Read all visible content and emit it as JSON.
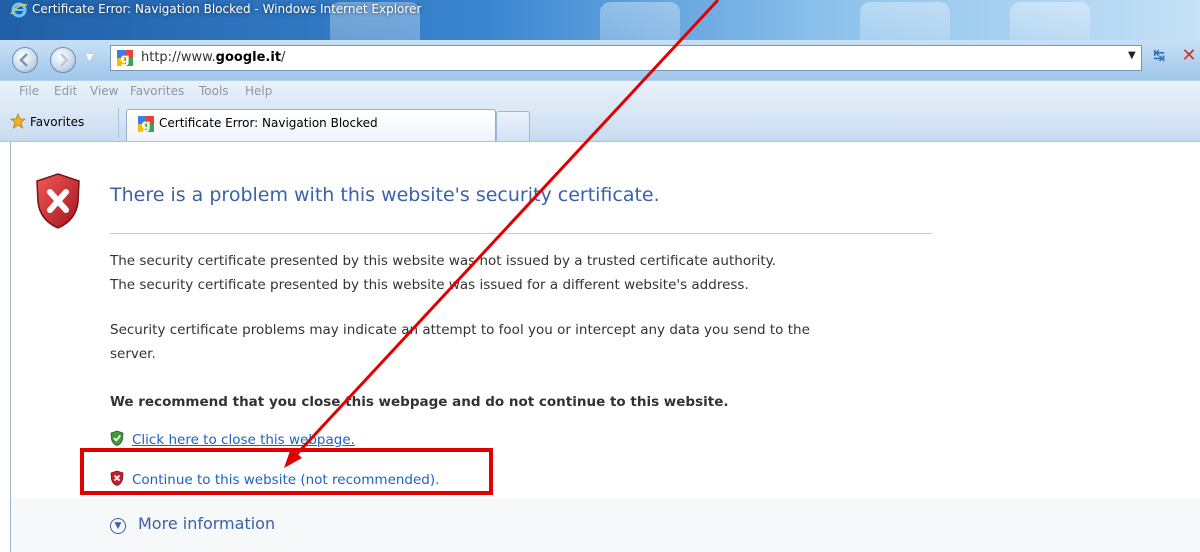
{
  "window": {
    "title": "Certificate Error: Navigation Blocked - Windows Internet Explorer"
  },
  "navbar": {
    "address_prefix": "http://www.",
    "address_domain": "google.it",
    "address_suffix": "/"
  },
  "menubar": {
    "items": [
      "File",
      "Edit",
      "View",
      "Favorites",
      "Tools",
      "Help"
    ]
  },
  "favbar": {
    "favorites_label": "Favorites",
    "tab_label": "Certificate Error: Navigation Blocked"
  },
  "page": {
    "headline": "There is a problem with this website's security certificate.",
    "issue_1": "The security certificate presented by this website was not issued by a trusted certificate authority.",
    "issue_2": "The security certificate presented by this website was issued for a different website's address.",
    "warning_line_1": "Security certificate problems may indicate an attempt to fool you or intercept any data you send to the",
    "warning_line_2": "server.",
    "recommend": "We recommend that you close this webpage and do not continue to this website.",
    "close_link": "Click here to close this webpage.",
    "continue_link": "Continue to this website (not recommended).",
    "more_info": "More information"
  },
  "colors": {
    "headline": "#3a62a8",
    "link": "#1b62c1",
    "annotation": "#e00000",
    "error_shield": "#c8202a",
    "ok_shield": "#3f9b3a"
  },
  "icons": {
    "error": "shield-x-icon",
    "ok": "shield-check-icon",
    "more": "chevron-down-circle-icon"
  }
}
